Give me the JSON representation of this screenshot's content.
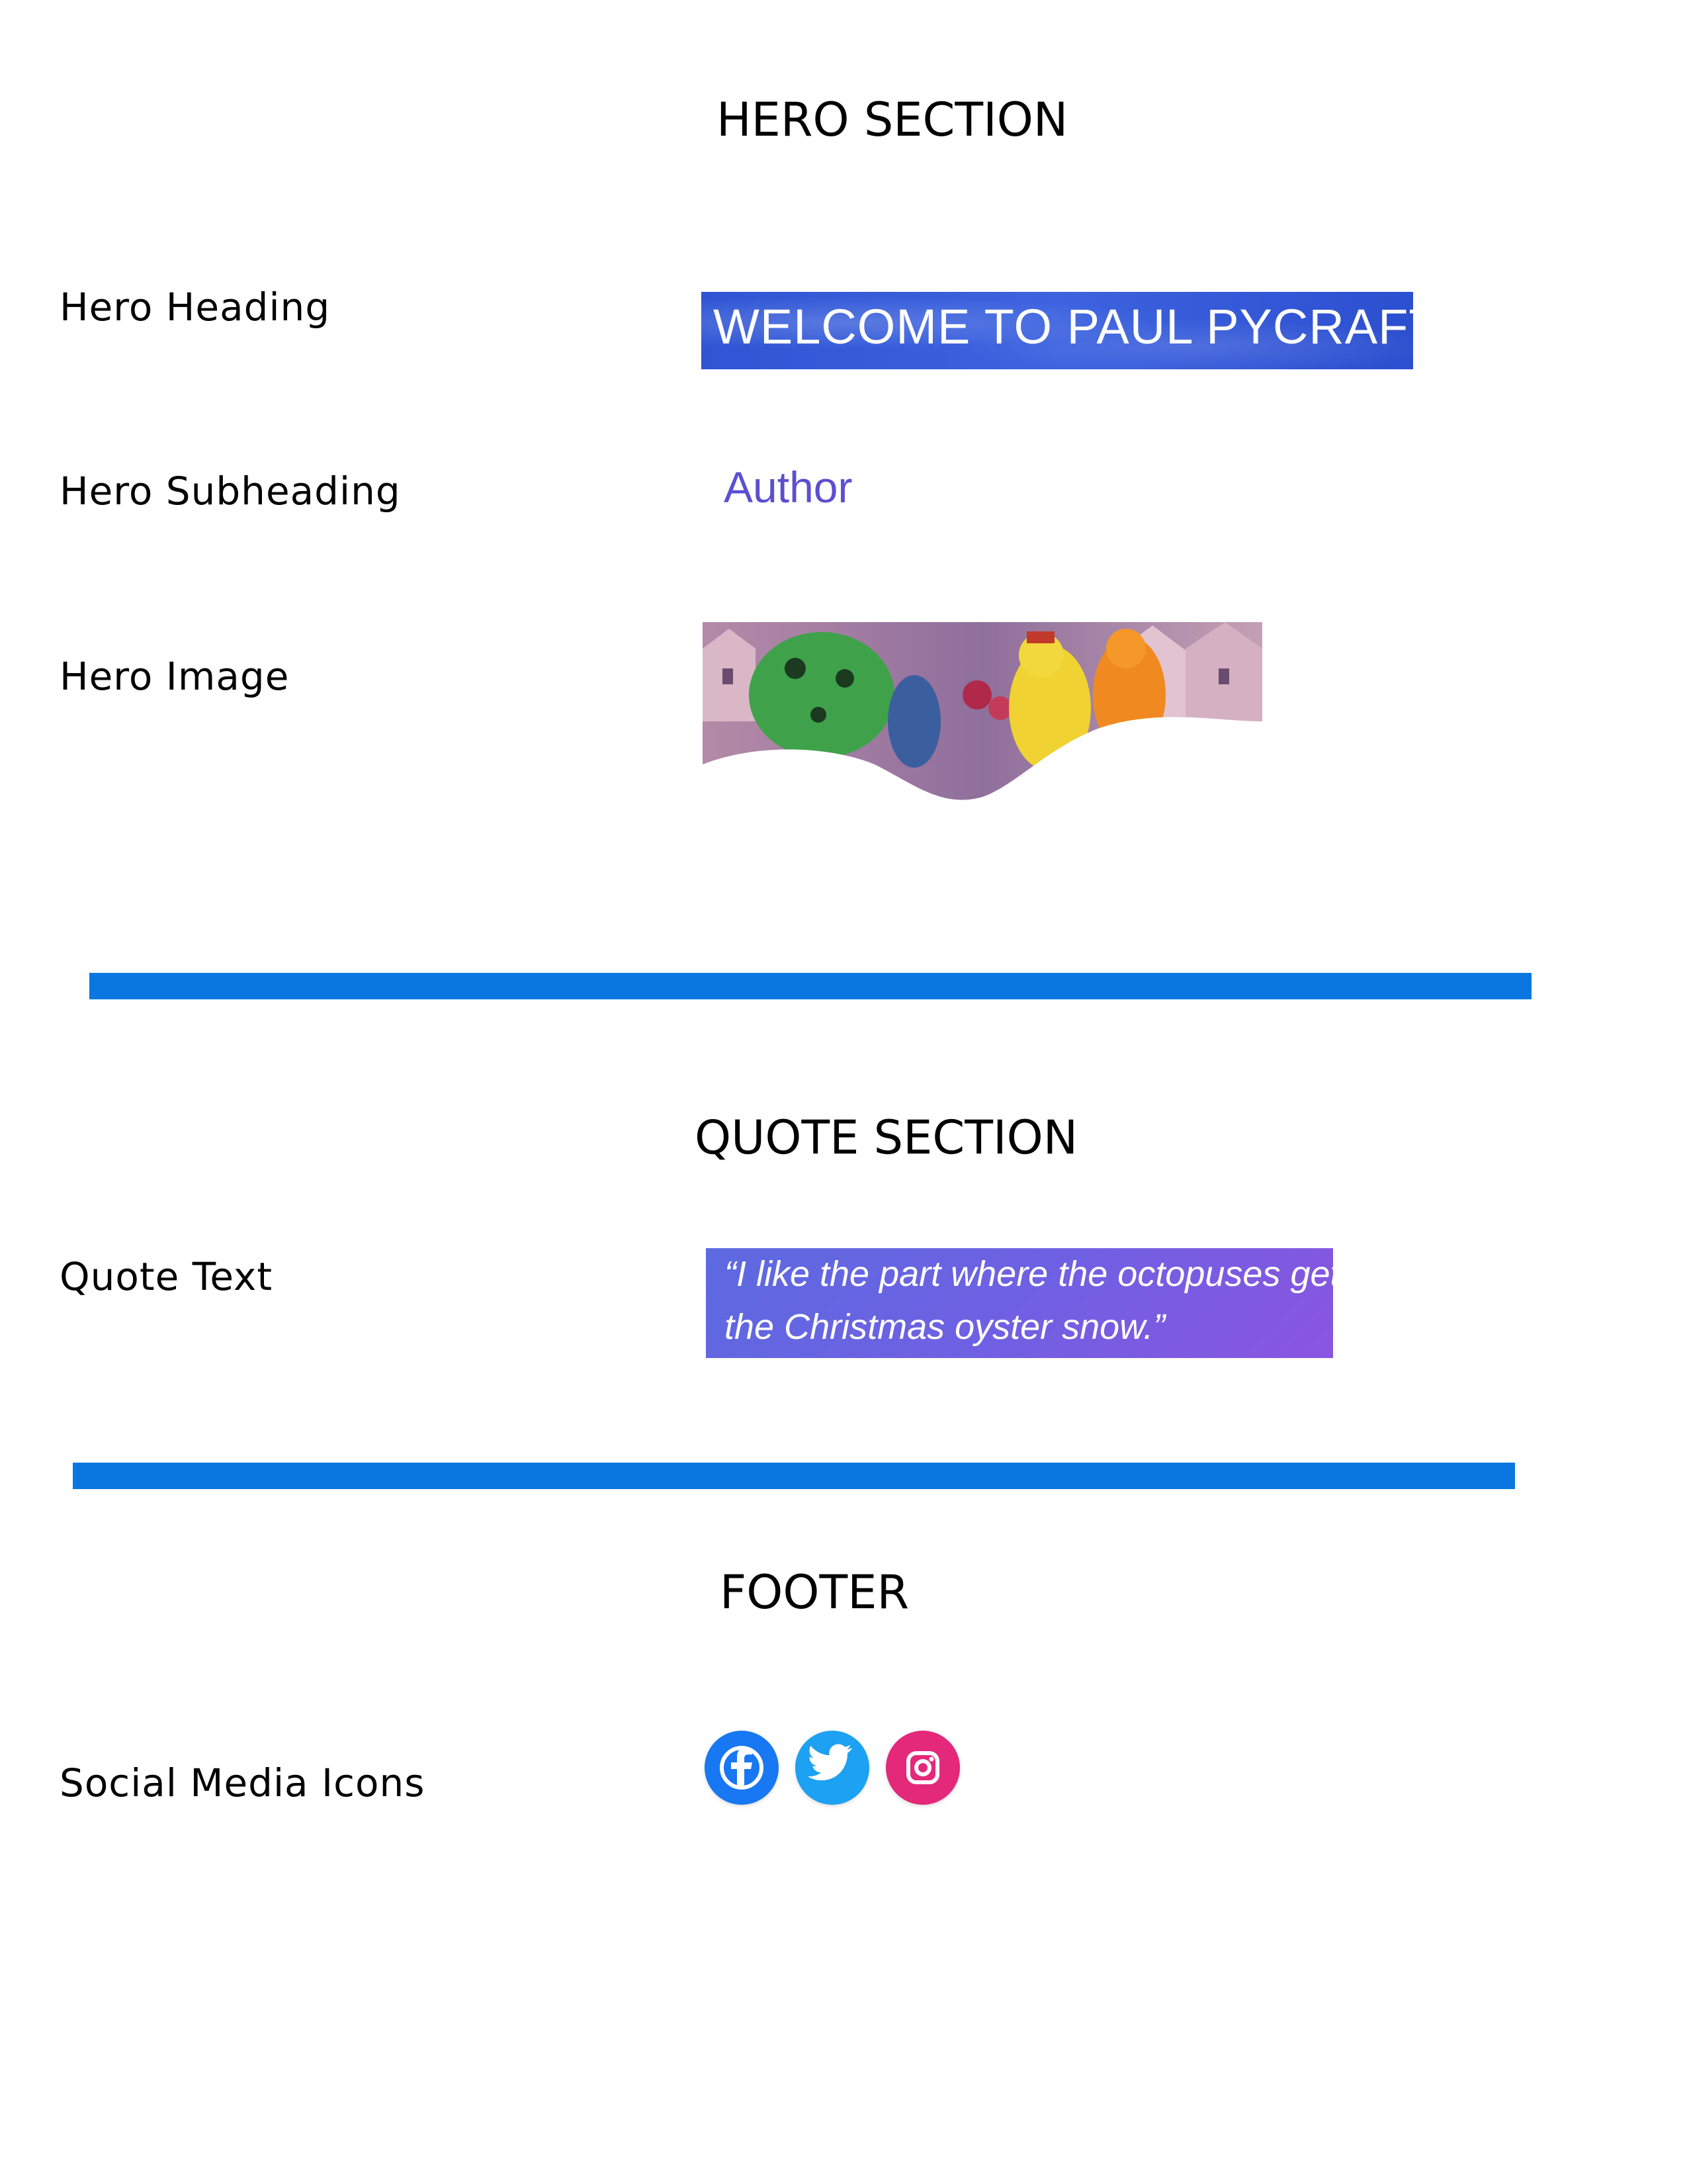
{
  "hero": {
    "section_title": "HERO SECTION",
    "heading_label": "Hero Heading",
    "heading_text": "WELCOME TO PAUL PYCRAFT",
    "subheading_label": "Hero Subheading",
    "subheading_text": "Author",
    "image_label": "Hero Image"
  },
  "quote": {
    "section_title": "QUOTE SECTION",
    "label": "Quote Text",
    "line1": "“I like the part where the octopuses get",
    "line2": "the Christmas oyster snow.”"
  },
  "footer": {
    "section_title": "FOOTER",
    "social_label": "Social Media Icons",
    "icons": [
      "facebook-icon",
      "twitter-icon",
      "instagram-icon"
    ]
  },
  "colors": {
    "divider": "#0a77e0",
    "facebook": "#1877f2",
    "twitter": "#1da1f2",
    "instagram": "#e4287a",
    "subheading": "#5a4fd1"
  }
}
